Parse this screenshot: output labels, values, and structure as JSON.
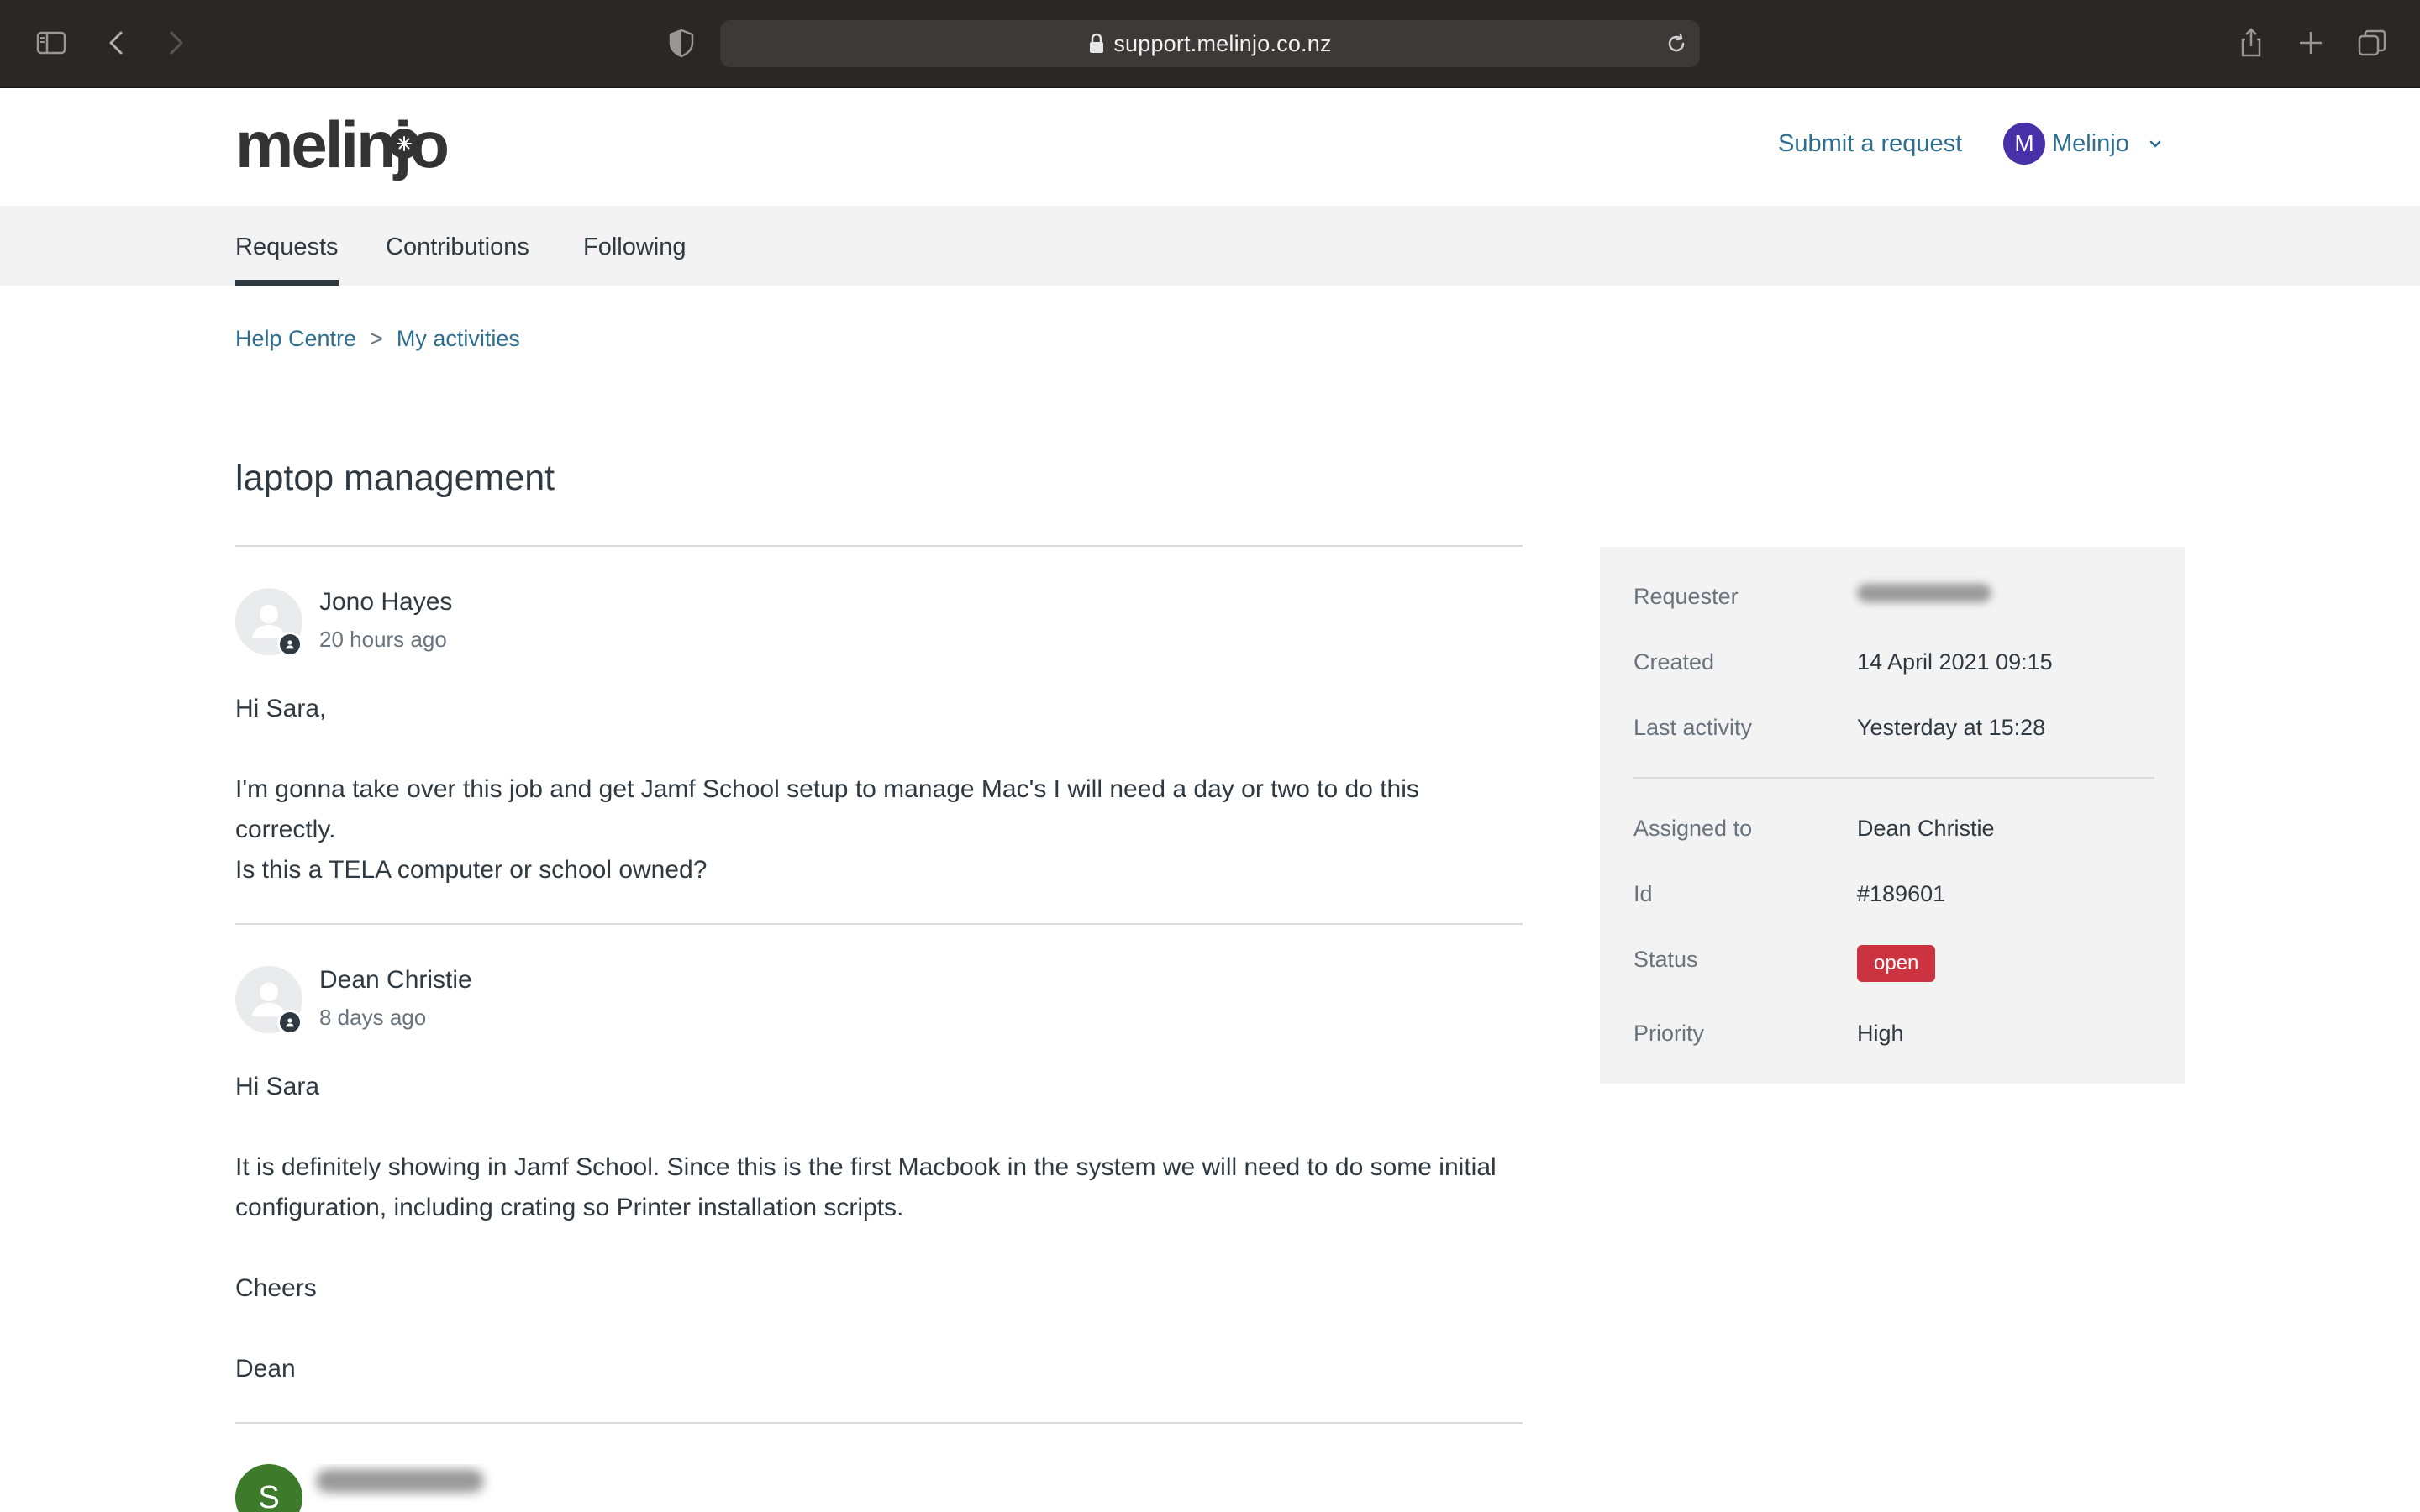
{
  "browser": {
    "url": "support.melinjo.co.nz"
  },
  "header": {
    "logo": "melinjo",
    "submit_request": "Submit a request",
    "user_initial": "M",
    "user_name": "Melinjo"
  },
  "tabs": [
    {
      "label": "Requests",
      "active": true
    },
    {
      "label": "Contributions",
      "active": false
    },
    {
      "label": "Following",
      "active": false
    }
  ],
  "breadcrumb": {
    "home": "Help Centre",
    "separator": ">",
    "current": "My activities"
  },
  "request": {
    "title": "laptop management"
  },
  "comments": [
    {
      "author": "Jono Hayes",
      "time": "20 hours ago",
      "paragraphs": [
        "Hi Sara,",
        "I'm gonna take over this job and get Jamf School setup to manage Mac's I will need a day or two to do this correctly.",
        "Is this a TELA computer or school owned?"
      ]
    },
    {
      "author": "Dean Christie",
      "time": "8 days ago",
      "paragraphs": [
        "Hi Sara",
        "It is definitely showing in Jamf School. Since this is the first Macbook in the system we will need to do some initial configuration, including crating so Printer installation scripts.",
        "Cheers",
        "Dean"
      ]
    },
    {
      "avatar_initial": "S"
    }
  ],
  "details": {
    "requester_label": "Requester",
    "created_label": "Created",
    "created_value": "14 April 2021 09:15",
    "last_activity_label": "Last activity",
    "last_activity_value": "Yesterday at 15:28",
    "assigned_label": "Assigned to",
    "assigned_value": "Dean Christie",
    "id_label": "Id",
    "id_value": "#189601",
    "status_label": "Status",
    "status_value": "open",
    "priority_label": "Priority",
    "priority_value": "High"
  },
  "colors": {
    "brand_link": "#2e6e8e",
    "user_avatar": "#4830a8",
    "status_open": "#cc3340",
    "s_avatar": "#3d7a2a"
  }
}
